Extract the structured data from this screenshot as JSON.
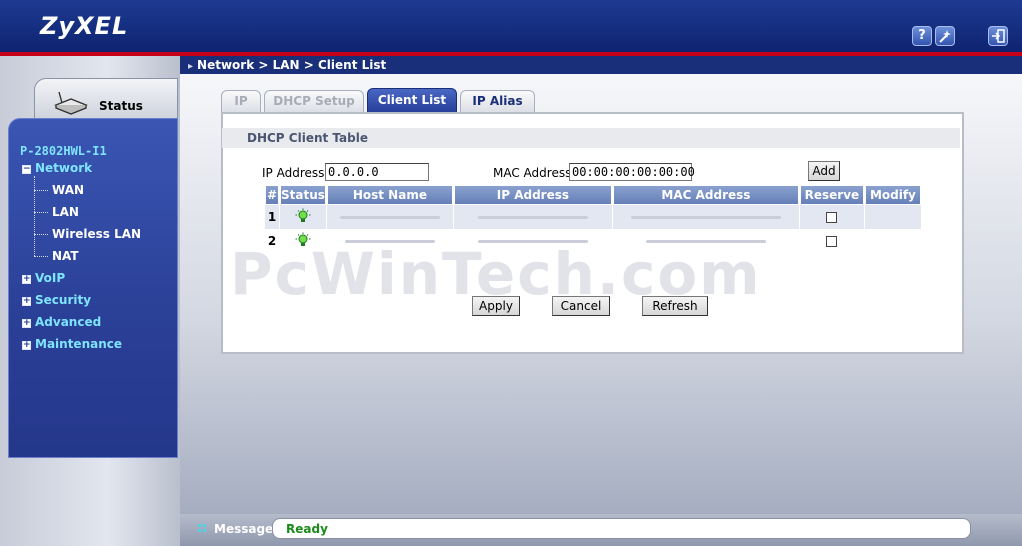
{
  "header": {
    "brand": "ZyXEL",
    "icons": [
      "help-icon",
      "wizard-icon",
      "logout-icon"
    ]
  },
  "breadcrumb": "Network > LAN > Client List",
  "sidebar": {
    "status_label": "Status",
    "device": "P-2802HWL-I1",
    "network": {
      "label": "Network",
      "children": [
        "WAN",
        "LAN",
        "Wireless LAN",
        "NAT"
      ]
    },
    "sections": [
      "VoIP",
      "Security",
      "Advanced",
      "Maintenance"
    ]
  },
  "tabs": [
    {
      "label": "IP",
      "state": "disabled"
    },
    {
      "label": "DHCP Setup",
      "state": "disabled"
    },
    {
      "label": "Client List",
      "state": "active"
    },
    {
      "label": "IP Alias",
      "state": "enabled"
    }
  ],
  "section_title": "DHCP Client Table",
  "form": {
    "ip_label": "IP Address",
    "ip_value": "0.0.0.0",
    "mac_label": "MAC Address",
    "mac_value": "00:00:00:00:00:00",
    "add_label": "Add"
  },
  "table": {
    "columns": [
      "#",
      "Status",
      "Host Name",
      "IP Address",
      "MAC Address",
      "Reserve",
      "Modify"
    ],
    "rows": [
      {
        "index": "1",
        "status_icon": "bulb-on-icon",
        "reserved": false
      },
      {
        "index": "2",
        "status_icon": "bulb-on-icon",
        "reserved": false
      }
    ]
  },
  "buttons": {
    "apply": "Apply",
    "cancel": "Cancel",
    "refresh": "Refresh"
  },
  "watermark": "PcWinTech.com",
  "status_bar": {
    "label": "Message",
    "text": "Ready"
  },
  "colors": {
    "header_blue": "#1d3a92",
    "accent_red": "#c8001a",
    "nav_cyan": "#7fe4ff",
    "ready_green": "#1a8a1a"
  }
}
